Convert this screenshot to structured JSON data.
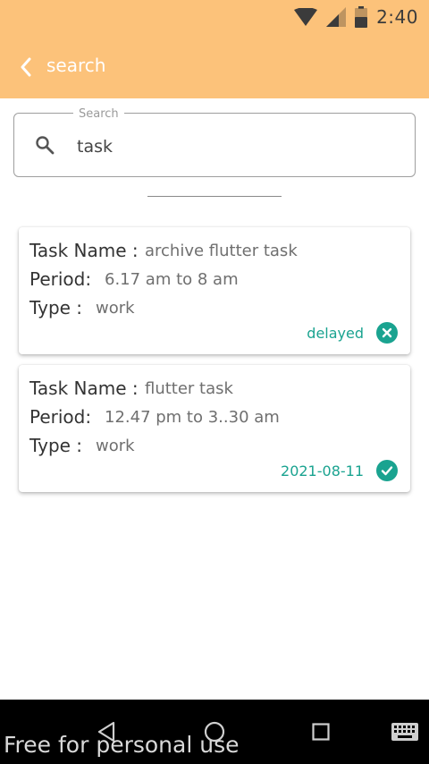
{
  "status_bar": {
    "time": "2:40",
    "icons": [
      "wifi-icon",
      "signal-icon",
      "battery-icon"
    ]
  },
  "app_bar": {
    "title": "search",
    "back_icon": "chevron-left-icon"
  },
  "search": {
    "label": "Search",
    "value": "task",
    "icon": "search-icon"
  },
  "tasks": [
    {
      "name_label": "Task Name :",
      "name": "archive flutter task",
      "period_label": "Period:",
      "period": "6.17 am to 8 am",
      "type_label": "Type :",
      "type": "work",
      "status": "delayed",
      "status_icon": "cancel-circle-icon"
    },
    {
      "name_label": "Task Name :",
      "name": "flutter task",
      "period_label": "Period:",
      "period": "12.47 pm to 3..30 am",
      "type_label": "Type :",
      "type": "work",
      "status": "2021-08-11",
      "status_icon": "check-circle-icon"
    }
  ],
  "nav_bar": {
    "icons": [
      "back-triangle-icon",
      "home-circle-icon",
      "recents-square-icon",
      "keyboard-icon"
    ]
  },
  "watermark": "Free for personal use",
  "colors": {
    "app_bar": "#fcc27a",
    "accent": "#1aa390",
    "nav_bar": "#000000"
  }
}
